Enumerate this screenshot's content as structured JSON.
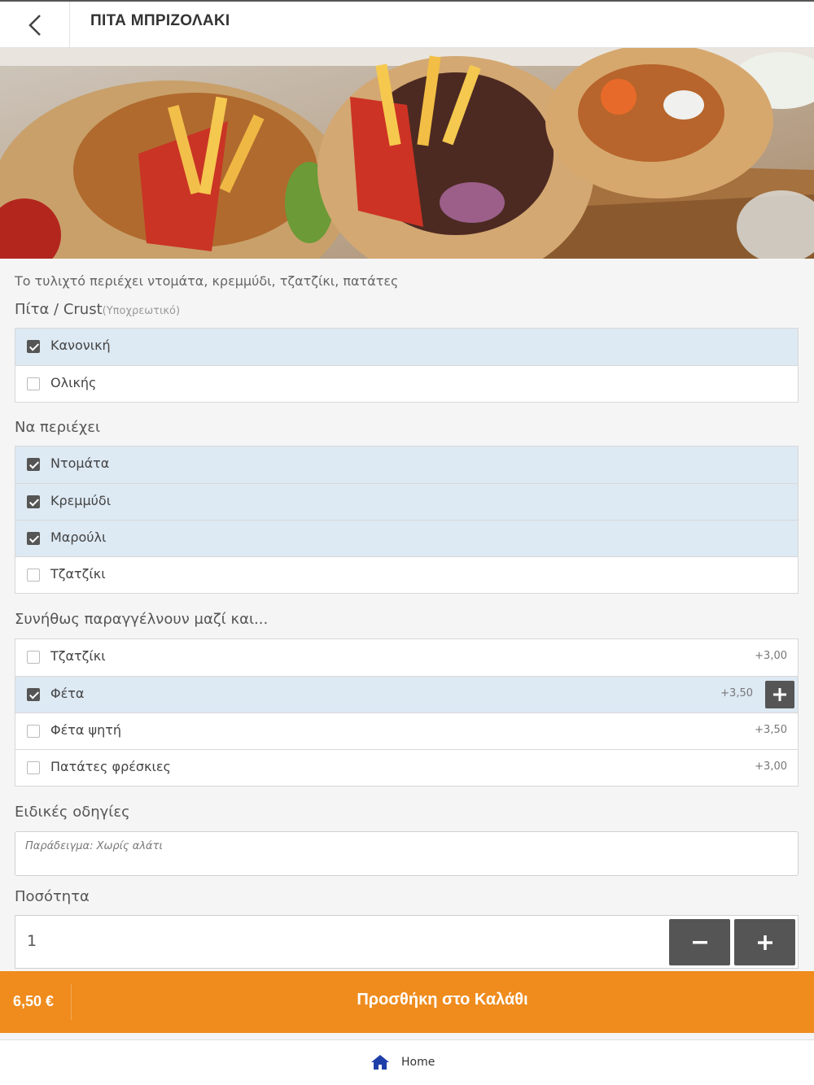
{
  "header": {
    "title": "ΠΙΤΑ ΜΠΡΙΖΟΛΑΚΙ",
    "back_icon": "chevron-left-icon"
  },
  "description": "Το τυλιχτό περιέχει ντομάτα, κρεμμύδι, τζατζίκι, πατάτες",
  "sections": {
    "crust": {
      "title": "Πίτα / Crust",
      "optional_note": "(Υποχρεωτικό)",
      "options": [
        {
          "label": "Κανονική",
          "checked": true
        },
        {
          "label": "Ολικής",
          "checked": false
        }
      ]
    },
    "includes": {
      "title": "Να περιέχει",
      "options": [
        {
          "label": "Ντομάτα",
          "checked": true
        },
        {
          "label": "Κρεμμύδι",
          "checked": true
        },
        {
          "label": "Μαρούλι",
          "checked": true
        },
        {
          "label": "Τζατζίκι",
          "checked": false
        }
      ]
    },
    "extras": {
      "title": "Συνήθως παραγγέλνουν μαζί και...",
      "options": [
        {
          "label": "Τζατζίκι",
          "price": "+3,00",
          "checked": false
        },
        {
          "label": "Φέτα",
          "price": "+3,50",
          "checked": true
        },
        {
          "label": "Φέτα ψητή",
          "price": "+3,50",
          "checked": false
        },
        {
          "label": "Πατάτες φρέσκιες",
          "price": "+3,00",
          "checked": false
        }
      ]
    }
  },
  "notes": {
    "title": "Ειδικές οδηγίες",
    "placeholder": "Παράδειγμα: Χωρίς αλάτι"
  },
  "quantity": {
    "title": "Ποσότητα",
    "value": "1",
    "minus_icon": "minus-icon",
    "plus_icon": "plus-icon"
  },
  "cart": {
    "price": "6,50 €",
    "label": "Προσθήκη στο Καλάθι"
  },
  "footer": {
    "home_label": "Home",
    "home_icon": "home-icon"
  },
  "colors": {
    "accent": "#ef8c1d",
    "checked_row": "#dde9f3",
    "dark_button": "#555555",
    "home_icon": "#1f3fa8"
  }
}
